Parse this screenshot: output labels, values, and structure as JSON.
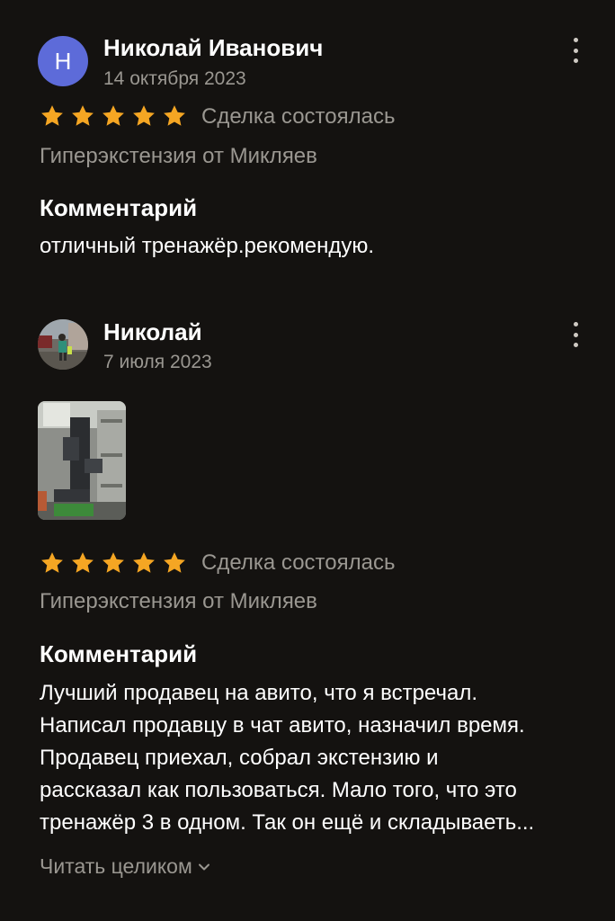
{
  "reviews": [
    {
      "avatar_letter": "Н",
      "author": "Николай Иванович",
      "date": "14 октября 2023",
      "rating": 5,
      "deal_status": "Сделка состоялась",
      "item": "Гиперэкстензия от Микляев",
      "comment_title": "Комментарий",
      "comment_lines": [
        "отличный тренажёр.рекомендую."
      ]
    },
    {
      "author": "Николай",
      "date": "7 июля 2023",
      "rating": 5,
      "deal_status": "Сделка состоялась",
      "item": "Гиперэкстензия от Микляев",
      "comment_title": "Комментарий",
      "comment_lines": [
        "Лучший продавец на авито, что я встречал.",
        "Написал продавцу в чат авито, назначил время.",
        "Продавец приехал, собрал экстензию и",
        "рассказал как пользоваться. Мало того, что это",
        "тренажёр 3 в одном. Так он ещё и складываеть..."
      ],
      "read_more": "Читать целиком"
    }
  ],
  "colors": {
    "background": "#141210",
    "star": "#f5a623",
    "muted_text": "#9a9791",
    "avatar_bg": "#5d6bd9"
  },
  "icons": {
    "star": "star-icon",
    "menu": "more-vertical-icon",
    "chevron": "chevron-down-icon"
  }
}
